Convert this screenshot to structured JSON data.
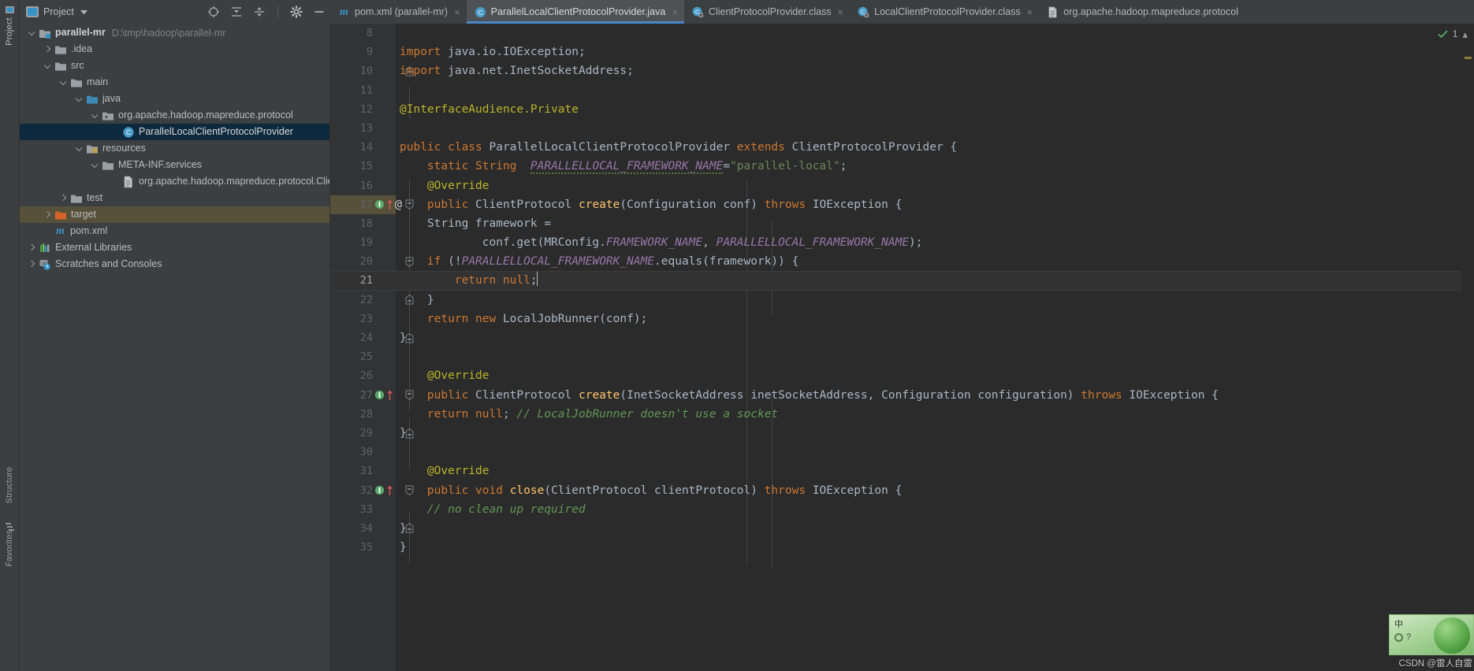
{
  "window": {
    "left_strip": {
      "project_label": "Project",
      "structure_label": "Structure",
      "favorites_label": "Favorites"
    }
  },
  "tool_window": {
    "title": "Project",
    "icon": "project-module-icon",
    "dropdown_icon": "chevron-down-icon",
    "actions": [
      {
        "name": "locate-icon",
        "tooltip": "Select Opened File"
      },
      {
        "name": "expand-all-icon",
        "tooltip": "Expand All"
      },
      {
        "name": "collapse-all-icon",
        "tooltip": "Collapse All"
      },
      {
        "name": "settings-gear-icon",
        "tooltip": "Settings"
      },
      {
        "name": "hide-icon",
        "tooltip": "Hide"
      }
    ]
  },
  "tabs": [
    {
      "label": "pom.xml (parallel-mr)",
      "icon": "maven-file-icon",
      "active": false,
      "close": "×"
    },
    {
      "label": "ParallelLocalClientProtocolProvider.java",
      "icon": "java-class-icon",
      "active": true,
      "close": "×"
    },
    {
      "label": "ClientProtocolProvider.class",
      "icon": "java-class-locked-icon",
      "active": false,
      "close": "×"
    },
    {
      "label": "LocalClientProtocolProvider.class",
      "icon": "java-class-locked-icon",
      "active": false,
      "close": "×"
    },
    {
      "label": "org.apache.hadoop.mapreduce.protocol",
      "icon": "text-file-icon",
      "active": false,
      "close": ""
    }
  ],
  "project_tree": [
    {
      "indent": 0,
      "arrow": "down",
      "icon": "module-folder-icon",
      "label": "parallel-mr",
      "path": "D:\\tmp\\hadoop\\parallel-mr",
      "bold": true,
      "state": "normal"
    },
    {
      "indent": 1,
      "arrow": "right",
      "icon": "folder-icon",
      "label": ".idea",
      "path": "",
      "bold": false,
      "state": "normal"
    },
    {
      "indent": 1,
      "arrow": "down",
      "icon": "folder-icon",
      "label": "src",
      "path": "",
      "bold": false,
      "state": "normal"
    },
    {
      "indent": 2,
      "arrow": "down",
      "icon": "folder-icon",
      "label": "main",
      "path": "",
      "bold": false,
      "state": "normal"
    },
    {
      "indent": 3,
      "arrow": "down",
      "icon": "source-folder-icon",
      "label": "java",
      "path": "",
      "bold": false,
      "state": "normal"
    },
    {
      "indent": 4,
      "arrow": "down",
      "icon": "package-icon",
      "label": "org.apache.hadoop.mapreduce.protocol",
      "path": "",
      "bold": false,
      "state": "normal"
    },
    {
      "indent": 5,
      "arrow": "none",
      "icon": "java-class-icon",
      "label": "ParallelLocalClientProtocolProvider",
      "path": "",
      "bold": false,
      "state": "selected"
    },
    {
      "indent": 3,
      "arrow": "down",
      "icon": "resource-folder-icon",
      "label": "resources",
      "path": "",
      "bold": false,
      "state": "normal"
    },
    {
      "indent": 4,
      "arrow": "down",
      "icon": "folder-icon",
      "label": "META-INF.services",
      "path": "",
      "bold": false,
      "state": "normal"
    },
    {
      "indent": 5,
      "arrow": "none",
      "icon": "text-file-icon",
      "label": "org.apache.hadoop.mapreduce.protocol.Client",
      "path": "",
      "bold": false,
      "state": "normal"
    },
    {
      "indent": 2,
      "arrow": "right",
      "icon": "folder-icon",
      "label": "test",
      "path": "",
      "bold": false,
      "state": "normal"
    },
    {
      "indent": 1,
      "arrow": "right",
      "icon": "excluded-folder-icon",
      "label": "target",
      "path": "",
      "bold": false,
      "state": "marked"
    },
    {
      "indent": 1,
      "arrow": "none",
      "icon": "maven-file-icon",
      "label": "pom.xml",
      "path": "",
      "bold": false,
      "state": "normal"
    },
    {
      "indent": 0,
      "arrow": "right",
      "icon": "libraries-icon",
      "label": "External Libraries",
      "path": "",
      "bold": false,
      "state": "normal"
    },
    {
      "indent": 0,
      "arrow": "right",
      "icon": "scratches-icon",
      "label": "Scratches and Consoles",
      "path": "",
      "bold": false,
      "state": "normal"
    }
  ],
  "editor": {
    "language": "java",
    "caret_line": 21,
    "status": {
      "warning_count": "1",
      "icon": "inspections-ok-icon",
      "collapse_icon": "chevron-up-icon"
    },
    "first_visible_line": 8,
    "lines": [
      {
        "n": "8",
        "fold": "",
        "gutter": [],
        "tokens": []
      },
      {
        "n": "9",
        "fold": "",
        "gutter": [],
        "tokens": [
          {
            "t": "import ",
            "c": "kw"
          },
          {
            "t": "java.io.IOException;",
            "c": "plain"
          }
        ]
      },
      {
        "n": "10",
        "fold": "start",
        "gutter": [],
        "tokens": [
          {
            "t": "import ",
            "c": "kw"
          },
          {
            "t": "java.net.InetSocketAddress;",
            "c": "plain"
          }
        ]
      },
      {
        "n": "11",
        "fold": "",
        "gutter": [],
        "tokens": []
      },
      {
        "n": "12",
        "fold": "",
        "gutter": [],
        "tokens": [
          {
            "t": "@InterfaceAudience.",
            "c": "ann"
          },
          {
            "t": "Private",
            "c": "ann"
          }
        ]
      },
      {
        "n": "13",
        "fold": "",
        "gutter": [],
        "tokens": []
      },
      {
        "n": "14",
        "fold": "",
        "gutter": [],
        "tokens": [
          {
            "t": "public class ",
            "c": "kw"
          },
          {
            "t": "ParallelLocalClientProtocolProvider ",
            "c": "plain"
          },
          {
            "t": "extends ",
            "c": "kw"
          },
          {
            "t": "ClientProtocolProvider {",
            "c": "plain"
          }
        ]
      },
      {
        "n": "15",
        "fold": "",
        "gutter": [],
        "tokens": [
          {
            "t": "    ",
            "c": "plain"
          },
          {
            "t": "static String ",
            "c": "kw"
          },
          {
            "t": " PARALLELLOCAL_FRAMEWORK_NAME",
            "c": "fld-warn"
          },
          {
            "t": "=",
            "c": "plain"
          },
          {
            "t": "\"parallel-local\"",
            "c": "str"
          },
          {
            "t": ";",
            "c": "plain"
          }
        ]
      },
      {
        "n": "16",
        "fold": "",
        "gutter": [],
        "tokens": [
          {
            "t": "    ",
            "c": "plain"
          },
          {
            "t": "@Override",
            "c": "ann"
          }
        ]
      },
      {
        "n": "17",
        "fold": "start",
        "gutter": [
          "override-impl-icon",
          "override-arrow-icon",
          "annotation-at-icon"
        ],
        "tokens": [
          {
            "t": "    ",
            "c": "plain"
          },
          {
            "t": "public ",
            "c": "kw"
          },
          {
            "t": "ClientProtocol ",
            "c": "plain"
          },
          {
            "t": "create",
            "c": "mth"
          },
          {
            "t": "(Configuration conf) ",
            "c": "plain"
          },
          {
            "t": "throws ",
            "c": "kw"
          },
          {
            "t": "IOException {",
            "c": "plain"
          }
        ]
      },
      {
        "n": "18",
        "fold": "",
        "gutter": [],
        "tokens": [
          {
            "t": "        String framework =",
            "c": "plain"
          }
        ]
      },
      {
        "n": "19",
        "fold": "",
        "gutter": [],
        "tokens": [
          {
            "t": "                conf.get(MRConfig.",
            "c": "plain"
          },
          {
            "t": "FRAMEWORK_NAME",
            "c": "fld"
          },
          {
            "t": ", ",
            "c": "plain"
          },
          {
            "t": "PARALLELLOCAL_FRAMEWORK_NAME",
            "c": "fld"
          },
          {
            "t": ");",
            "c": "plain"
          }
        ]
      },
      {
        "n": "20",
        "fold": "start",
        "gutter": [],
        "tokens": [
          {
            "t": "        ",
            "c": "plain"
          },
          {
            "t": "if ",
            "c": "kw"
          },
          {
            "t": "(!",
            "c": "plain"
          },
          {
            "t": "PARALLELLOCAL_FRAMEWORK_NAME",
            "c": "fld"
          },
          {
            "t": ".equals(framework)) {",
            "c": "plain"
          }
        ]
      },
      {
        "n": "21",
        "fold": "",
        "gutter": [],
        "caret": true,
        "tokens": [
          {
            "t": "            ",
            "c": "plain"
          },
          {
            "t": "return null",
            "c": "kw"
          },
          {
            "t": ";",
            "c": "plain"
          }
        ]
      },
      {
        "n": "22",
        "fold": "end",
        "gutter": [],
        "tokens": [
          {
            "t": "        }",
            "c": "plain"
          }
        ]
      },
      {
        "n": "23",
        "fold": "",
        "gutter": [],
        "tokens": [
          {
            "t": "        ",
            "c": "plain"
          },
          {
            "t": "return new ",
            "c": "kw"
          },
          {
            "t": "LocalJobRunner(conf);",
            "c": "plain"
          }
        ]
      },
      {
        "n": "24",
        "fold": "end",
        "gutter": [],
        "tokens": [
          {
            "t": "    }",
            "c": "plain"
          }
        ]
      },
      {
        "n": "25",
        "fold": "",
        "gutter": [],
        "tokens": []
      },
      {
        "n": "26",
        "fold": "",
        "gutter": [],
        "tokens": [
          {
            "t": "    ",
            "c": "plain"
          },
          {
            "t": "@Override",
            "c": "ann"
          }
        ]
      },
      {
        "n": "27",
        "fold": "start",
        "gutter": [
          "override-impl-icon",
          "override-arrow-icon"
        ],
        "tokens": [
          {
            "t": "    ",
            "c": "plain"
          },
          {
            "t": "public ",
            "c": "kw"
          },
          {
            "t": "ClientProtocol ",
            "c": "plain"
          },
          {
            "t": "create",
            "c": "mth"
          },
          {
            "t": "(InetSocketAddress inetSocketAddress, Configuration configuration) ",
            "c": "plain"
          },
          {
            "t": "throws ",
            "c": "kw"
          },
          {
            "t": "IOException {",
            "c": "plain"
          }
        ]
      },
      {
        "n": "28",
        "fold": "",
        "gutter": [],
        "tokens": [
          {
            "t": "        ",
            "c": "plain"
          },
          {
            "t": "return null",
            "c": "kw"
          },
          {
            "t": "; ",
            "c": "plain"
          },
          {
            "t": "// LocalJobRunner doesn't use a socket",
            "c": "cmt-it"
          }
        ]
      },
      {
        "n": "29",
        "fold": "end",
        "gutter": [],
        "tokens": [
          {
            "t": "    }",
            "c": "plain"
          }
        ]
      },
      {
        "n": "30",
        "fold": "",
        "gutter": [],
        "tokens": []
      },
      {
        "n": "31",
        "fold": "",
        "gutter": [],
        "tokens": [
          {
            "t": "    ",
            "c": "plain"
          },
          {
            "t": "@Override",
            "c": "ann"
          }
        ]
      },
      {
        "n": "32",
        "fold": "start",
        "gutter": [
          "override-impl-icon",
          "override-arrow-icon"
        ],
        "tokens": [
          {
            "t": "    ",
            "c": "plain"
          },
          {
            "t": "public void ",
            "c": "kw"
          },
          {
            "t": "close",
            "c": "mth"
          },
          {
            "t": "(ClientProtocol clientProtocol) ",
            "c": "plain"
          },
          {
            "t": "throws ",
            "c": "kw"
          },
          {
            "t": "IOException {",
            "c": "plain"
          }
        ]
      },
      {
        "n": "33",
        "fold": "",
        "gutter": [],
        "tokens": [
          {
            "t": "        ",
            "c": "plain"
          },
          {
            "t": "// no clean up required",
            "c": "cmt-it"
          }
        ]
      },
      {
        "n": "34",
        "fold": "end",
        "gutter": [],
        "tokens": [
          {
            "t": "    }",
            "c": "plain"
          }
        ]
      },
      {
        "n": "35",
        "fold": "",
        "gutter": [],
        "tokens": [
          {
            "t": "}",
            "c": "plain"
          }
        ]
      }
    ]
  },
  "watermark": {
    "ime_label": "中",
    "question_mark": "?",
    "credit": "CSDN @雷人自雷"
  },
  "colors": {
    "editor_bg": "#2b2b2b",
    "gutter_bg": "#313335",
    "panel_bg": "#3c3f41",
    "tab_active_bg": "#4e5254",
    "tab_underline": "#4a88c7",
    "selection_bg": "#0d293e",
    "marked_bg": "#57503b",
    "keyword": "#cc7832",
    "string": "#6a8759",
    "annotation": "#bbb529",
    "field": "#9876aa",
    "method": "#ffc66d",
    "comment": "#629755",
    "text": "#a9b7c6"
  }
}
